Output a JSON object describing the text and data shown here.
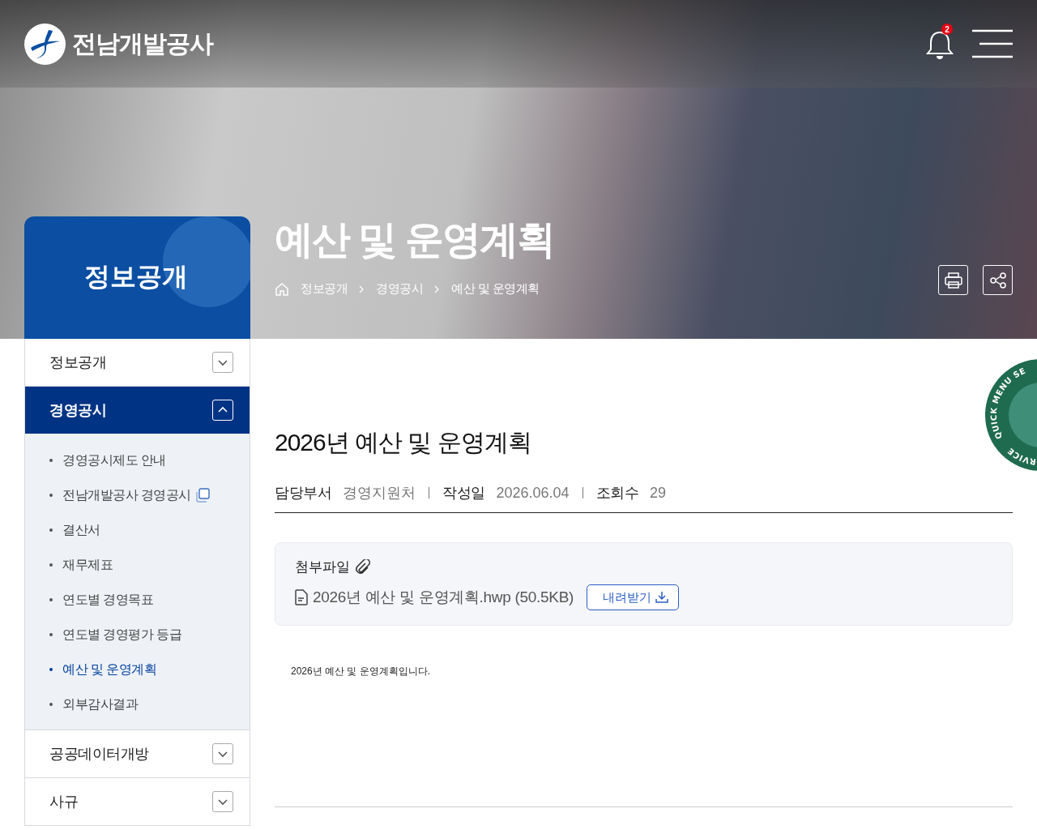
{
  "site": {
    "logo_text": "전남개발공사",
    "notification_count": "2"
  },
  "hero": {
    "section_title": "정보공개",
    "page_title": "예산 및 운영계획",
    "breadcrumb": [
      "정보공개",
      "경영공시",
      "예산 및 운영계획"
    ]
  },
  "sidebar": {
    "items": [
      {
        "label": "정보공개",
        "expanded": false
      },
      {
        "label": "경영공시",
        "expanded": true,
        "children": [
          {
            "label": "경영공시제도 안내",
            "selected": false,
            "new_window": false
          },
          {
            "label": "전남개발공사 경영공시",
            "selected": false,
            "new_window": true
          },
          {
            "label": "결산서",
            "selected": false,
            "new_window": false
          },
          {
            "label": "재무제표",
            "selected": false,
            "new_window": false
          },
          {
            "label": "연도별 경영목표",
            "selected": false,
            "new_window": false
          },
          {
            "label": "연도별 경영평가 등급",
            "selected": false,
            "new_window": false
          },
          {
            "label": "예산 및 운영계획",
            "selected": true,
            "new_window": false
          },
          {
            "label": "외부감사결과",
            "selected": false,
            "new_window": false
          }
        ]
      },
      {
        "label": "공공데이터개방",
        "expanded": false
      },
      {
        "label": "사규",
        "expanded": false
      }
    ]
  },
  "quick_menu": {
    "text_top": "QUICK MENU SE",
    "text_bottom": "RVICE"
  },
  "post": {
    "title": "2026년 예산 및 운영계획",
    "meta": [
      {
        "label": "담당부서",
        "value": "경영지원처"
      },
      {
        "label": "작성일",
        "value": "2026.06.04"
      },
      {
        "label": "조회수",
        "value": "29"
      }
    ],
    "attachment": {
      "heading": "첨부파일",
      "file": "2026년 예산 및 운영계획.hwp (50.5KB)",
      "button": "내려받기"
    },
    "body": "2026년 예산 및 운영계획입니다."
  }
}
